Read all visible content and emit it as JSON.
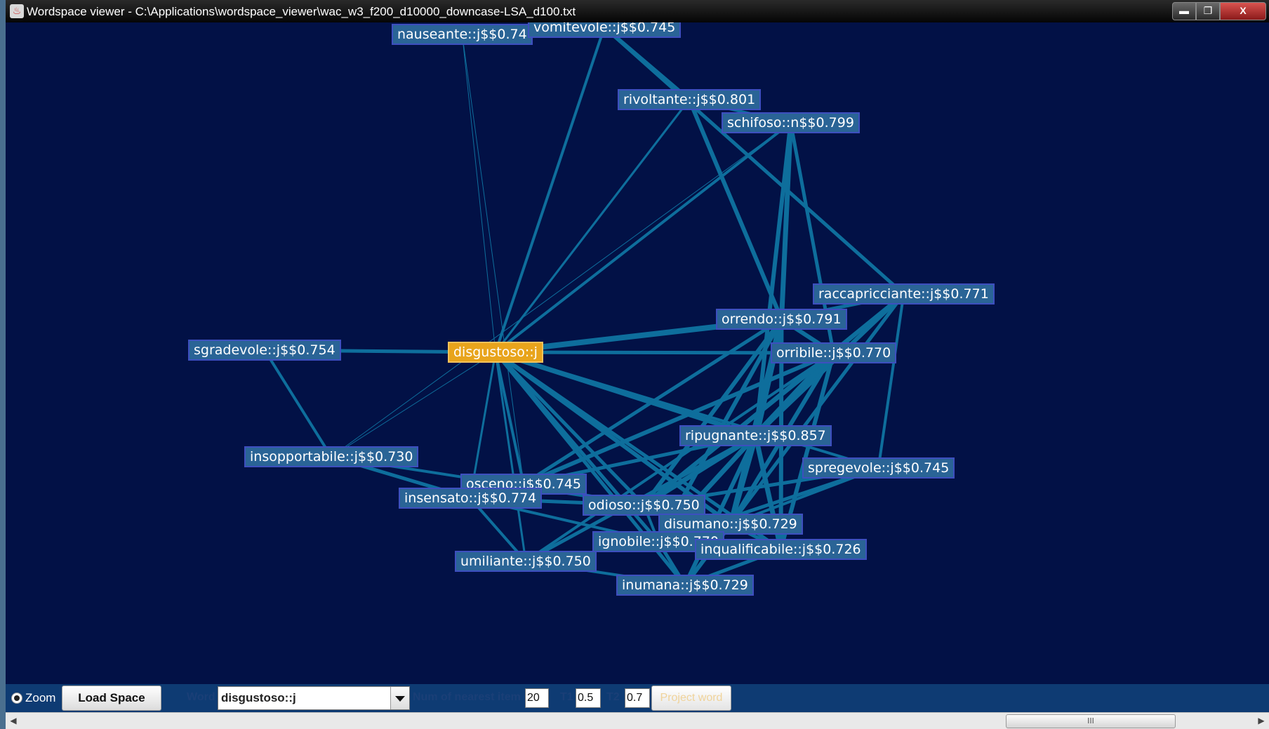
{
  "window": {
    "title": "Wordspace viewer - C:\\Applications\\wordspace_viewer\\wac_w3_f200_d10000_downcase-LSA_d100.txt",
    "buttons": {
      "minimize": "▬",
      "restore": "❐",
      "close": "X"
    }
  },
  "graph": {
    "focus": "disgustoso::j",
    "edge_color": "#0e6e9c",
    "node_color": "#2a6496",
    "focus_color": "#e8a41c",
    "nodes": [
      {
        "id": "nauseante",
        "label": "nauseante::j$$0.74"
      },
      {
        "id": "vomitevole",
        "label": "vomitevole::j$$0.745"
      },
      {
        "id": "rivoltante",
        "label": "rivoltante::j$$0.801"
      },
      {
        "id": "schifoso",
        "label": "schifoso::n$$0.799"
      },
      {
        "id": "raccapricciante",
        "label": "raccapricciante::j$$0.771"
      },
      {
        "id": "orrendo",
        "label": "orrendo::j$$0.791"
      },
      {
        "id": "orribile",
        "label": "orribile::j$$0.770"
      },
      {
        "id": "sgradevole",
        "label": "sgradevole::j$$0.754"
      },
      {
        "id": "disgustoso",
        "label": "disgustoso::j"
      },
      {
        "id": "ripugnante",
        "label": "ripugnante::j$$0.857"
      },
      {
        "id": "spregevole",
        "label": "spregevole::j$$0.745"
      },
      {
        "id": "insopportabile",
        "label": "insopportabile::j$$0.730"
      },
      {
        "id": "osceno",
        "label": "osceno::j$$0.745"
      },
      {
        "id": "insensato",
        "label": "insensato::j$$0.774"
      },
      {
        "id": "odioso",
        "label": "odioso::j$$0.750"
      },
      {
        "id": "disumano",
        "label": "disumano::j$$0.729"
      },
      {
        "id": "ignobile",
        "label": "ignobile::j$$0.770"
      },
      {
        "id": "inqualificabile",
        "label": "inqualificabile::j$$0.726"
      },
      {
        "id": "umiliante",
        "label": "umiliante::j$$0.750"
      },
      {
        "id": "inumana",
        "label": "inumana::j$$0.729"
      }
    ],
    "edges": [
      [
        "disgustoso",
        "nauseante",
        1
      ],
      [
        "disgustoso",
        "vomitevole",
        4
      ],
      [
        "disgustoso",
        "rivoltante",
        3
      ],
      [
        "disgustoso",
        "schifoso",
        4
      ],
      [
        "disgustoso",
        "orrendo",
        8
      ],
      [
        "disgustoso",
        "orribile",
        5
      ],
      [
        "disgustoso",
        "sgradevole",
        5
      ],
      [
        "disgustoso",
        "ripugnante",
        7
      ],
      [
        "disgustoso",
        "spregevole",
        4
      ],
      [
        "disgustoso",
        "insopportabile",
        1
      ],
      [
        "disgustoso",
        "osceno",
        4
      ],
      [
        "disgustoso",
        "insensato",
        3
      ],
      [
        "disgustoso",
        "odioso",
        5
      ],
      [
        "disgustoso",
        "disumano",
        6
      ],
      [
        "disgustoso",
        "ignobile",
        5
      ],
      [
        "disgustoso",
        "inqualificabile",
        5
      ],
      [
        "disgustoso",
        "umiliante",
        3
      ],
      [
        "disgustoso",
        "inumana",
        5
      ],
      [
        "vomitevole",
        "rivoltante",
        6
      ],
      [
        "vomitevole",
        "raccapricciante",
        5
      ],
      [
        "rivoltante",
        "schifoso",
        4
      ],
      [
        "rivoltante",
        "orrendo",
        6
      ],
      [
        "schifoso",
        "orrendo",
        7
      ],
      [
        "schifoso",
        "ripugnante",
        6
      ],
      [
        "schifoso",
        "orribile",
        5
      ],
      [
        "raccapricciante",
        "orrendo",
        5
      ],
      [
        "raccapricciante",
        "orribile",
        5
      ],
      [
        "raccapricciante",
        "ripugnante",
        6
      ],
      [
        "raccapricciante",
        "spregevole",
        4
      ],
      [
        "raccapricciante",
        "odioso",
        5
      ],
      [
        "raccapricciante",
        "disumano",
        5
      ],
      [
        "orrendo",
        "orribile",
        6
      ],
      [
        "orrendo",
        "ripugnante",
        10
      ],
      [
        "orrendo",
        "osceno",
        5
      ],
      [
        "orrendo",
        "odioso",
        6
      ],
      [
        "orrendo",
        "disumano",
        7
      ],
      [
        "orrendo",
        "ignobile",
        6
      ],
      [
        "orrendo",
        "inqualificabile",
        6
      ],
      [
        "orribile",
        "ripugnante",
        9
      ],
      [
        "orribile",
        "osceno",
        6
      ],
      [
        "orribile",
        "odioso",
        6
      ],
      [
        "orribile",
        "disumano",
        6
      ],
      [
        "orribile",
        "inqualificabile",
        6
      ],
      [
        "orribile",
        "umiliante",
        4
      ],
      [
        "ripugnante",
        "osceno",
        5
      ],
      [
        "ripugnante",
        "odioso",
        7
      ],
      [
        "ripugnante",
        "disumano",
        8
      ],
      [
        "ripugnante",
        "ignobile",
        7
      ],
      [
        "ripugnante",
        "inqualificabile",
        7
      ],
      [
        "ripugnante",
        "inumana",
        6
      ],
      [
        "ripugnante",
        "umiliante",
        5
      ],
      [
        "spregevole",
        "odioso",
        5
      ],
      [
        "spregevole",
        "ignobile",
        5
      ],
      [
        "spregevole",
        "disumano",
        4
      ],
      [
        "sgradevole",
        "insopportabile",
        4
      ],
      [
        "insopportabile",
        "insensato",
        5
      ],
      [
        "insopportabile",
        "odioso",
        4
      ],
      [
        "insensato",
        "odioso",
        5
      ],
      [
        "insensato",
        "umiliante",
        4
      ],
      [
        "insensato",
        "ignobile",
        4
      ],
      [
        "osceno",
        "odioso",
        4
      ],
      [
        "odioso",
        "disumano",
        5
      ],
      [
        "odioso",
        "ignobile",
        4
      ],
      [
        "disumano",
        "inumana",
        6
      ],
      [
        "disumano",
        "inqualificabile",
        5
      ],
      [
        "ignobile",
        "inqualificabile",
        5
      ],
      [
        "ignobile",
        "inumana",
        5
      ],
      [
        "umiliante",
        "inumana",
        4
      ],
      [
        "inqualificabile",
        "inumana",
        5
      ],
      [
        "nauseante",
        "osceno",
        1
      ],
      [
        "schifoso",
        "insopportabile",
        1
      ],
      [
        "rivoltante",
        "disgustoso",
        3
      ]
    ]
  },
  "controls": {
    "zoom_label": "Zoom",
    "load_button": "Load Space",
    "word_label": "Word",
    "word_value": "disgustoso::j",
    "nearest_label": "Num of nearest item",
    "nearest_value": "20",
    "t1_label": "T1",
    "t1_value": "0.5",
    "t2_label": "T2",
    "t2_value": "0.7",
    "project_button": "Project word"
  },
  "scrollbar": {
    "thumb_grip": "III"
  }
}
